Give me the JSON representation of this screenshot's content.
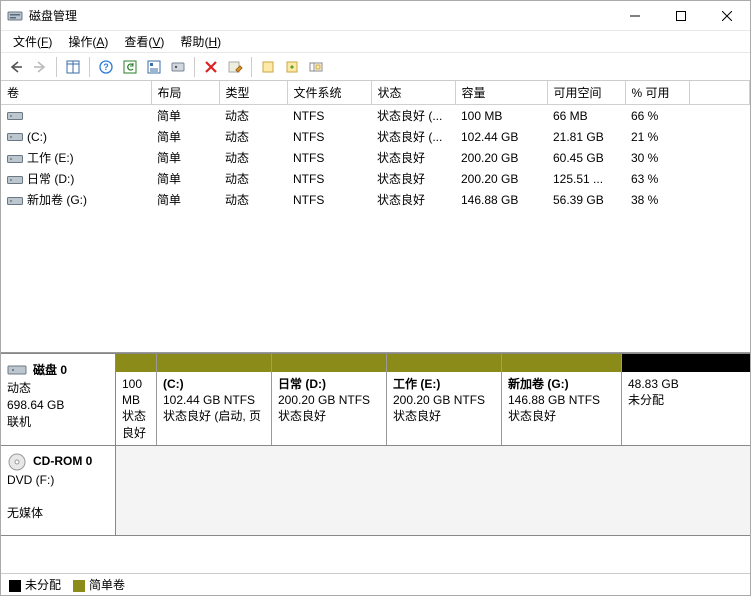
{
  "window": {
    "title": "磁盘管理"
  },
  "menu": {
    "file": "文件",
    "file_hot": "F",
    "action": "操作",
    "action_hot": "A",
    "view": "查看",
    "view_hot": "V",
    "help": "帮助",
    "help_hot": "H"
  },
  "columns": {
    "vol": "卷",
    "layout": "布局",
    "type": "类型",
    "fs": "文件系统",
    "status": "状态",
    "capacity": "容量",
    "free": "可用空间",
    "pct": "% 可用"
  },
  "volumes": [
    {
      "name": "",
      "layout": "简单",
      "type": "动态",
      "fs": "NTFS",
      "status": "状态良好 (...",
      "capacity": "100 MB",
      "free": "66 MB",
      "pct": "66 %"
    },
    {
      "name": "(C:)",
      "layout": "简单",
      "type": "动态",
      "fs": "NTFS",
      "status": "状态良好 (...",
      "capacity": "102.44 GB",
      "free": "21.81 GB",
      "pct": "21 %"
    },
    {
      "name": "工作 (E:)",
      "layout": "简单",
      "type": "动态",
      "fs": "NTFS",
      "status": "状态良好",
      "capacity": "200.20 GB",
      "free": "60.45 GB",
      "pct": "30 %"
    },
    {
      "name": "日常 (D:)",
      "layout": "简单",
      "type": "动态",
      "fs": "NTFS",
      "status": "状态良好",
      "capacity": "200.20 GB",
      "free": "125.51 ...",
      "pct": "63 %"
    },
    {
      "name": "新加卷 (G:)",
      "layout": "简单",
      "type": "动态",
      "fs": "NTFS",
      "status": "状态良好",
      "capacity": "146.88 GB",
      "free": "56.39 GB",
      "pct": "38 %"
    }
  ],
  "disk0": {
    "title": "磁盘 0",
    "type": "动态",
    "size": "698.64 GB",
    "status": "联机",
    "parts": [
      {
        "name": "",
        "size": "100 MB",
        "fs": "",
        "status": "状态良好",
        "colorClass": "c-olive",
        "width": 40
      },
      {
        "name": "(C:)",
        "size": "102.44 GB NTFS",
        "status": "状态良好 (启动, 页",
        "colorClass": "c-olive",
        "width": 115
      },
      {
        "name": "日常  (D:)",
        "size": "200.20 GB NTFS",
        "status": "状态良好",
        "colorClass": "c-olive",
        "width": 115
      },
      {
        "name": "工作  (E:)",
        "size": "200.20 GB NTFS",
        "status": "状态良好",
        "colorClass": "c-olive",
        "width": 115
      },
      {
        "name": "新加卷  (G:)",
        "size": "146.88 GB NTFS",
        "status": "状态良好",
        "colorClass": "c-olive",
        "width": 120
      },
      {
        "name": "",
        "size": "48.83 GB",
        "status": "未分配",
        "colorClass": "c-black",
        "width": 110
      }
    ]
  },
  "cdrom": {
    "title": "CD-ROM 0",
    "type": "DVD (F:)",
    "status": "无媒体"
  },
  "legend": {
    "unalloc": "未分配",
    "simple": "简单卷"
  }
}
